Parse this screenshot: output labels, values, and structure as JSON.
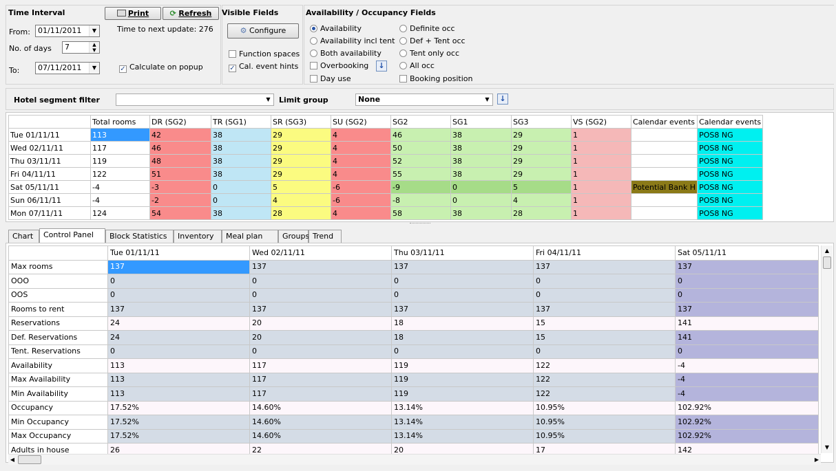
{
  "time_interval": {
    "title": "Time Interval",
    "from_label": "From:",
    "from_value": "01/11/2011",
    "days_label": "No. of days",
    "days_value": "7",
    "to_label": "To:",
    "to_value": "07/11/2011",
    "print_label": "Print",
    "refresh_label": "Refresh",
    "next_update": "Time to next update: 276",
    "calc_popup": "Calculate on popup"
  },
  "visible_fields": {
    "title": "Visible Fields",
    "configure_label": "Configure",
    "function_spaces": "Function spaces",
    "cal_event_hints": "Cal. event hints"
  },
  "avail_fields": {
    "title": "Availability / Occupancy Fields",
    "left": [
      "Availability",
      "Availability incl tent",
      "Both availability",
      "Overbooking",
      "Day use"
    ],
    "right": [
      "Definite occ",
      "Def + Tent occ",
      "Tent only occ",
      "All occ",
      "Booking position"
    ]
  },
  "filter": {
    "segment_label": "Hotel segment filter",
    "segment_value": "",
    "limit_label": "Limit group",
    "limit_value": "None"
  },
  "upper_grid": {
    "headers": [
      "",
      "Total rooms",
      "DR (SG2)",
      "TR (SG1)",
      "SR (SG3)",
      "SU (SG2)",
      "SG2",
      "SG1",
      "SG3",
      "VS (SG2)",
      "Calendar events",
      "Calendar events"
    ],
    "rows": [
      [
        "Tue 01/11/11",
        "113",
        "42",
        "38",
        "29",
        "4",
        "46",
        "38",
        "29",
        "1",
        "",
        "POS8 NG"
      ],
      [
        "Wed 02/11/11",
        "117",
        "46",
        "38",
        "29",
        "4",
        "50",
        "38",
        "29",
        "1",
        "",
        "POS8 NG"
      ],
      [
        "Thu 03/11/11",
        "119",
        "48",
        "38",
        "29",
        "4",
        "52",
        "38",
        "29",
        "1",
        "",
        "POS8 NG"
      ],
      [
        "Fri 04/11/11",
        "122",
        "51",
        "38",
        "29",
        "4",
        "55",
        "38",
        "29",
        "1",
        "",
        "POS8 NG"
      ],
      [
        "Sat 05/11/11",
        "-4",
        "-3",
        "0",
        "5",
        "-6",
        "-9",
        "0",
        "5",
        "1",
        "Potential Bank H",
        "POS8 NG"
      ],
      [
        "Sun 06/11/11",
        "-4",
        "-2",
        "0",
        "4",
        "-6",
        "-8",
        "0",
        "4",
        "1",
        "",
        "POS8 NG"
      ],
      [
        "Mon 07/11/11",
        "124",
        "54",
        "38",
        "28",
        "4",
        "58",
        "38",
        "28",
        "1",
        "",
        "POS8 NG"
      ]
    ],
    "colors": {
      "dr": "#f98b8b",
      "tr": "#bfe6f5",
      "sr": "#fbfb80",
      "su": "#f98b8b",
      "sg": "#c8f0b0",
      "sg_dark": "#a6dc88",
      "vs": "#f5b8b8",
      "cal_event": "#8b7a18",
      "cal_event2": "#00f0f0"
    }
  },
  "tabs": [
    "Chart",
    "Control Panel",
    "Block Statistics",
    "Inventory",
    "Meal plan",
    "Groups",
    "Trend"
  ],
  "active_tab": "Control Panel",
  "lower_grid": {
    "headers": [
      "",
      "Tue 01/11/11",
      "Wed 02/11/11",
      "Thu 03/11/11",
      "Fri 04/11/11",
      "Sat 05/11/11"
    ],
    "rows": [
      [
        "Max rooms",
        "137",
        "137",
        "137",
        "137",
        "137"
      ],
      [
        "OOO",
        "0",
        "0",
        "0",
        "0",
        "0"
      ],
      [
        "OOS",
        "0",
        "0",
        "0",
        "0",
        "0"
      ],
      [
        "Rooms to rent",
        "137",
        "137",
        "137",
        "137",
        "137"
      ],
      [
        "Reservations",
        "24",
        "20",
        "18",
        "15",
        "141"
      ],
      [
        "Def. Reservations",
        "24",
        "20",
        "18",
        "15",
        "141"
      ],
      [
        "Tent. Reservations",
        "0",
        "0",
        "0",
        "0",
        "0"
      ],
      [
        "Availability",
        "113",
        "117",
        "119",
        "122",
        "-4"
      ],
      [
        "Max Availability",
        "113",
        "117",
        "119",
        "122",
        "-4"
      ],
      [
        "Min Availability",
        "113",
        "117",
        "119",
        "122",
        "-4"
      ],
      [
        "Occupancy",
        "17.52%",
        "14.60%",
        "13.14%",
        "10.95%",
        "102.92%"
      ],
      [
        "Min Occupancy",
        "17.52%",
        "14.60%",
        "13.14%",
        "10.95%",
        "102.92%"
      ],
      [
        "Max Occupancy",
        "17.52%",
        "14.60%",
        "13.14%",
        "10.95%",
        "102.92%"
      ],
      [
        "Adults in house",
        "26",
        "22",
        "20",
        "17",
        "142"
      ]
    ],
    "colors": {
      "row_light": "#fdf6fb",
      "row_grey": "#d4dce6",
      "sat_purple": "#b4b4dc",
      "selected": "#3399ff"
    }
  }
}
